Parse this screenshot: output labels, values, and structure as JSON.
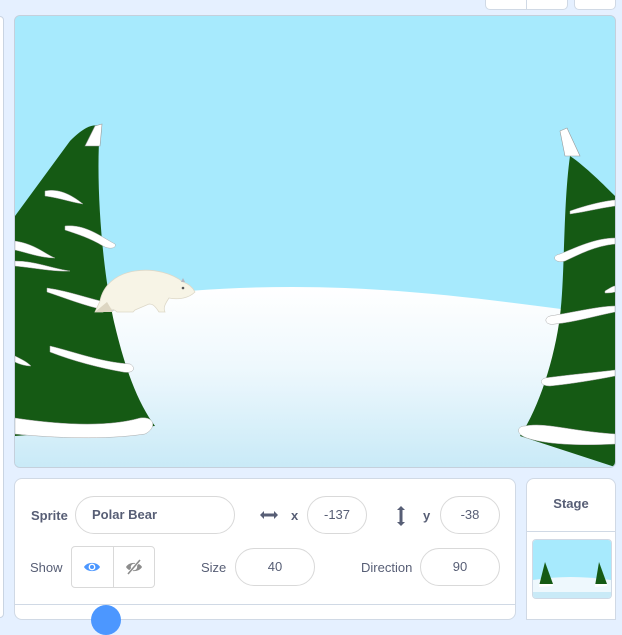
{
  "stage": {
    "backdrop": "winter-snowy-hill",
    "sprites_visible": [
      "Polar Bear"
    ],
    "colors": {
      "sky": "#a7eafd",
      "tree": "#155a14",
      "snow": "#ffffff"
    }
  },
  "sprite_info": {
    "sprite_label": "Sprite",
    "sprite_name": "Polar Bear",
    "x_icon": "horizontal-arrows-icon",
    "x_label": "x",
    "x_value": "-137",
    "y_icon": "vertical-arrows-icon",
    "y_label": "y",
    "y_value": "-38",
    "show_label": "Show",
    "show_visible_icon": "eye-icon",
    "show_hidden_icon": "eye-slash-icon",
    "show_state": "visible",
    "size_label": "Size",
    "size_value": "40",
    "direction_label": "Direction",
    "direction_value": "90"
  },
  "stage_panel": {
    "title": "Stage"
  },
  "colors": {
    "accent": "#4c97ff",
    "text": "#575e75",
    "background": "#e5f0ff"
  }
}
